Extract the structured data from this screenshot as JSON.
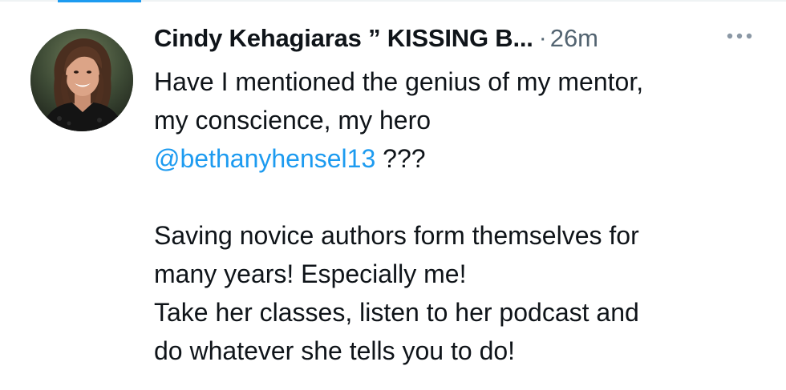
{
  "tweet": {
    "author_name": "Cindy Kehagiaras ” KISSING B...",
    "separator": "·",
    "timestamp": "26m",
    "body": {
      "line1": "Have I mentioned the genius of my mentor,",
      "line2": "my conscience, my hero",
      "mention": "@bethanyhensel13",
      "after_mention": " ???",
      "line5": "Saving novice authors form themselves for",
      "line6": "many years! Especially me!",
      "line7": "Take her classes, listen to her podcast and",
      "line8": "do whatever she tells you to do!"
    }
  },
  "icons": {
    "more": "more-horizontal-icon",
    "avatar": "profile-photo"
  },
  "colors": {
    "text": "#0f1419",
    "secondary": "#536471",
    "link": "#1d9bf0",
    "background": "#ffffff"
  }
}
